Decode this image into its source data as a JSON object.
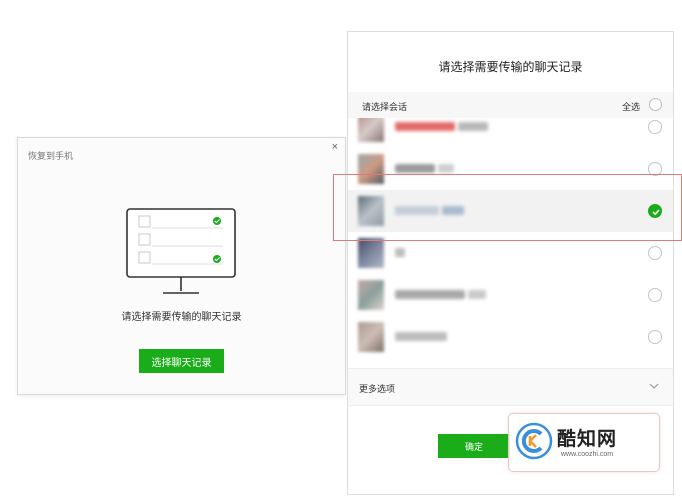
{
  "left_dialog": {
    "title": "恢复到手机",
    "close": "×",
    "prompt": "请选择需要传输的聊天记录",
    "button_label": "选择聊天记录"
  },
  "right_panel": {
    "title": "请选择需要传输的聊天记录",
    "select_label": "请选择会话",
    "select_all_label": "全选",
    "conversations": [
      {
        "avatar_colors": [
          "#b48a84",
          "#d6cbc9",
          "#8a7371"
        ],
        "name_colors": [
          "#e46b6b",
          "#b9b9b9"
        ],
        "selected": false
      },
      {
        "avatar_colors": [
          "#97a7ad",
          "#cf9a82",
          "#515a66"
        ],
        "name_colors": [
          "#9a9a9a",
          "#cfcfcf"
        ],
        "selected": false
      },
      {
        "avatar_colors": [
          "#5e6a74",
          "#b9c2c8",
          "#8d99a3"
        ],
        "name_colors": [
          "#c5cdd8",
          "#a9bad0"
        ],
        "selected": true
      },
      {
        "avatar_colors": [
          "#434a63",
          "#7d86a0",
          "#b3b8c6"
        ],
        "name_colors": [
          "#bdbdbd"
        ],
        "selected": false
      },
      {
        "avatar_colors": [
          "#c2aaa5",
          "#8b9f9c",
          "#dcd3cd"
        ],
        "name_colors": [
          "#a8a8a8",
          "#c9c9c9"
        ],
        "selected": false
      },
      {
        "avatar_colors": [
          "#ab9b94",
          "#cdbdb4",
          "#7d6e66"
        ],
        "name_colors": [
          "#bcbcbc"
        ],
        "selected": false
      }
    ],
    "more_options_label": "更多选项",
    "confirm_label": "确定"
  },
  "watermark": {
    "title": "酷知网",
    "url": "www.coozhi.com"
  },
  "colors": {
    "accent_green": "#1aad19",
    "highlight_red": "#e07a7a"
  }
}
